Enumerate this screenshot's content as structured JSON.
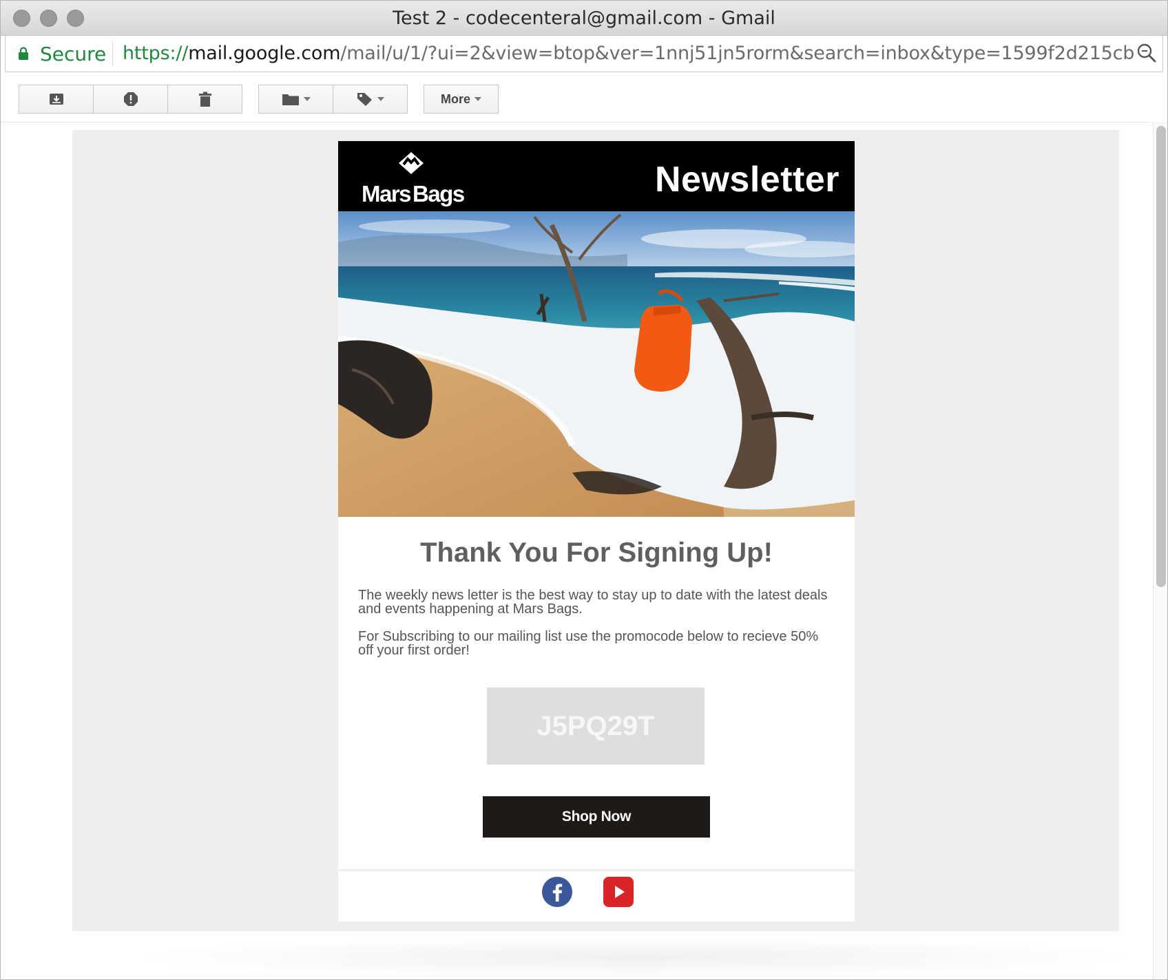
{
  "window": {
    "title": "Test 2 - codecenteral@gmail.com - Gmail"
  },
  "address_bar": {
    "secure_label": "Secure",
    "url_scheme": "https://",
    "url_host": "mail.google.com",
    "url_path": "/mail/u/1/?ui=2&view=btop&ver=1nnj51jn5rorm&search=inbox&type=1599f2d215cbfb…"
  },
  "toolbar": {
    "buttons": [
      {
        "icon": "archive-icon"
      },
      {
        "icon": "report-spam-icon"
      },
      {
        "icon": "delete-icon"
      },
      {
        "icon": "move-to-folder-icon"
      },
      {
        "icon": "labels-icon"
      }
    ],
    "more_label": "More"
  },
  "email": {
    "brand": {
      "word1": "Mars",
      "word2": "Bags"
    },
    "header_title": "Newsletter",
    "headline": "Thank You For Signing Up!",
    "paragraph1": "The weekly news letter is the best way to stay up to date with the latest deals and events happening at Mars Bags.",
    "paragraph2": "For Subscribing to our mailing list use the promocode below to recieve 50% off your first order!",
    "promo_code": "J5PQ29T",
    "cta_label": "Shop Now",
    "social": [
      "facebook-icon",
      "youtube-icon"
    ],
    "colors": {
      "header_bg": "#000000",
      "button_bg": "#1e1a17",
      "promo_bg": "#dedede",
      "facebook": "#3b5998",
      "youtube": "#d9252a"
    }
  }
}
